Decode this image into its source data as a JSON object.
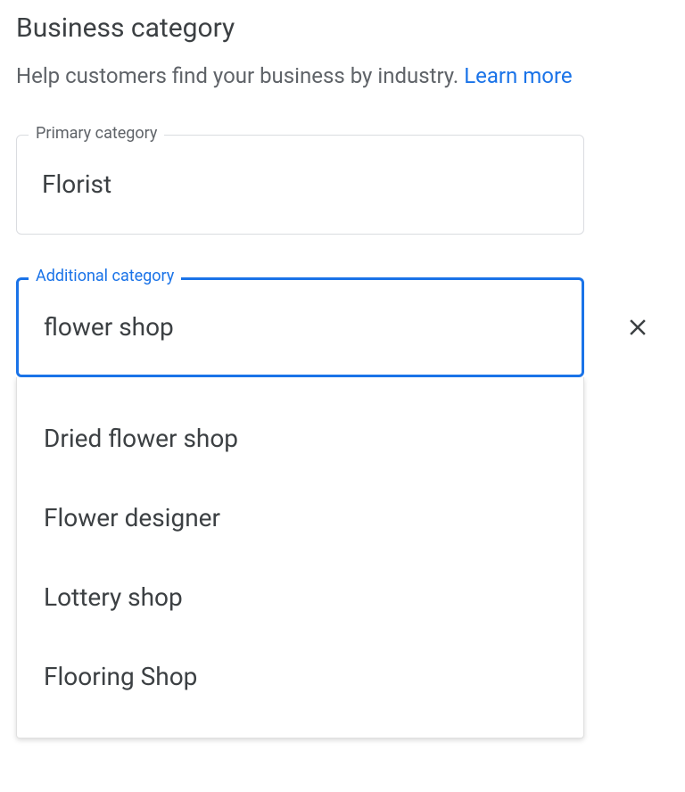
{
  "page": {
    "title": "Business category",
    "help_text": "Help customers find your business by industry. ",
    "learn_more": "Learn more"
  },
  "primary": {
    "label": "Primary category",
    "value": "Florist"
  },
  "additional": {
    "label": "Additional category",
    "value": "flower shop"
  },
  "suggestions": [
    "Dried flower shop",
    "Flower designer",
    "Lottery shop",
    "Flooring Shop"
  ]
}
